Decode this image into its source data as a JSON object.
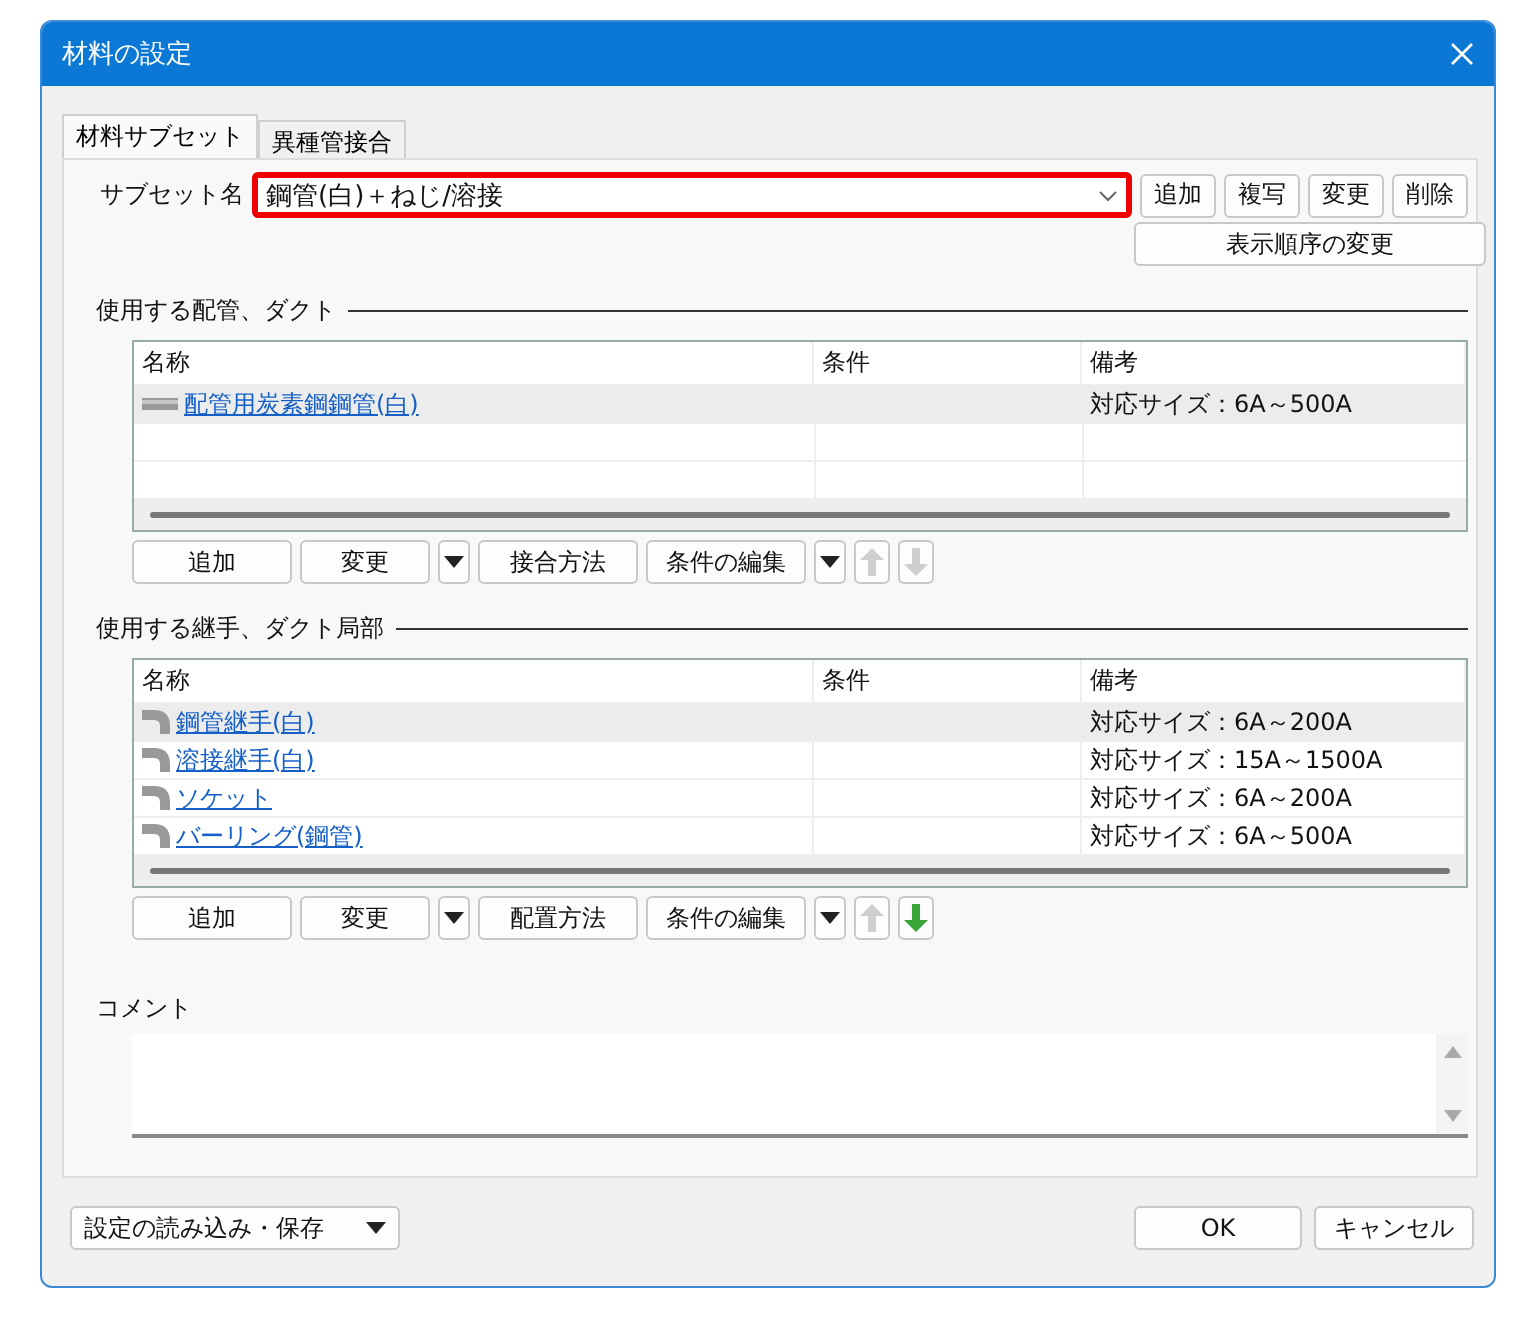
{
  "window": {
    "title": "材料の設定"
  },
  "tabs": [
    {
      "label": "材料サブセット",
      "selected": true
    },
    {
      "label": "異種管接合",
      "selected": false
    }
  ],
  "subset": {
    "label": "サブセット名",
    "value": "鋼管(白)＋ねじ/溶接",
    "highlighted": true,
    "buttons": [
      "追加",
      "複写",
      "変更",
      "削除"
    ],
    "reorder_button": "表示順序の変更"
  },
  "sections": [
    {
      "title": "使用する配管、ダクト",
      "columns": [
        "名称",
        "条件",
        "備考"
      ],
      "rows": [
        {
          "kind": "pipe",
          "name": "配管用炭素鋼鋼管(白)",
          "condition": "",
          "note": "対応サイズ：6A～500A",
          "selected": true
        }
      ],
      "buttons": [
        {
          "kind": "button",
          "label": "追加"
        },
        {
          "kind": "button",
          "label": "変更"
        },
        {
          "kind": "arrow"
        },
        {
          "kind": "button",
          "label": "接合方法"
        },
        {
          "kind": "button",
          "label": "条件の編集"
        },
        {
          "kind": "arrow"
        }
      ],
      "move_up": {
        "disabled": true
      },
      "move_down": {
        "disabled": true
      }
    },
    {
      "title": "使用する継手、ダクト局部",
      "columns": [
        "名称",
        "条件",
        "備考"
      ],
      "rows": [
        {
          "kind": "fitting",
          "name": "鋼管継手(白)",
          "condition": "",
          "note": "対応サイズ：6A～200A",
          "selected": true
        },
        {
          "kind": "fitting",
          "name": "溶接継手(白)",
          "condition": "",
          "note": "対応サイズ：15A～1500A",
          "selected": false
        },
        {
          "kind": "fitting",
          "name": "ソケット",
          "condition": "",
          "note": "対応サイズ：6A～200A",
          "selected": false
        },
        {
          "kind": "fitting",
          "name": "バーリング(鋼管)",
          "condition": "",
          "note": "対応サイズ：6A～500A",
          "selected": false
        }
      ],
      "buttons": [
        {
          "kind": "button",
          "label": "追加"
        },
        {
          "kind": "button",
          "label": "変更"
        },
        {
          "kind": "arrow"
        },
        {
          "kind": "button",
          "label": "配置方法"
        },
        {
          "kind": "button",
          "label": "条件の編集"
        },
        {
          "kind": "arrow"
        }
      ],
      "move_up": {
        "disabled": true
      },
      "move_down": {
        "disabled": false
      }
    }
  ],
  "comment": {
    "label": "コメント"
  },
  "footer": {
    "load_save_button": "設定の読み込み・保存",
    "ok_button": "OK",
    "cancel_button": "キャンセル"
  }
}
